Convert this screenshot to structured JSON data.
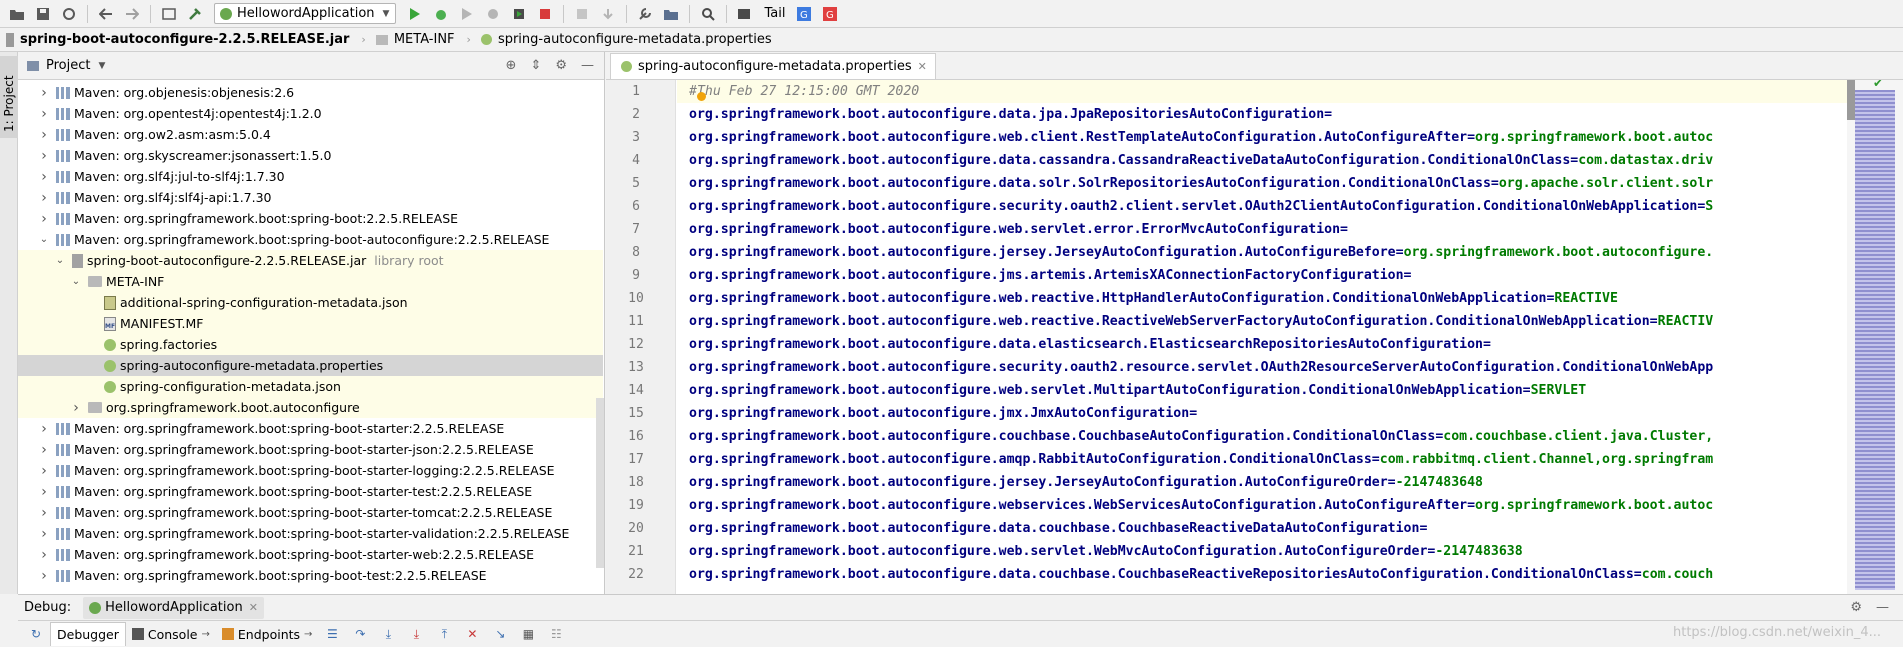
{
  "toolbar": {
    "run_config": "HellowordApplication",
    "tail_label": "Tail"
  },
  "breadcrumb": [
    "spring-boot-autoconfigure-2.2.5.RELEASE.jar",
    "META-INF",
    "spring-autoconfigure-metadata.properties"
  ],
  "side_strip": {
    "label": "1: Project"
  },
  "project_panel": {
    "title": "Project",
    "tree": [
      {
        "depth": 1,
        "arrow": "right",
        "icon": "lib",
        "label": "Maven: org.objenesis:objenesis:2.6"
      },
      {
        "depth": 1,
        "arrow": "right",
        "icon": "lib",
        "label": "Maven: org.opentest4j:opentest4j:1.2.0"
      },
      {
        "depth": 1,
        "arrow": "right",
        "icon": "lib",
        "label": "Maven: org.ow2.asm:asm:5.0.4"
      },
      {
        "depth": 1,
        "arrow": "right",
        "icon": "lib",
        "label": "Maven: org.skyscreamer:jsonassert:1.5.0"
      },
      {
        "depth": 1,
        "arrow": "right",
        "icon": "lib",
        "label": "Maven: org.slf4j:jul-to-slf4j:1.7.30"
      },
      {
        "depth": 1,
        "arrow": "right",
        "icon": "lib",
        "label": "Maven: org.slf4j:slf4j-api:1.7.30"
      },
      {
        "depth": 1,
        "arrow": "right",
        "icon": "lib",
        "label": "Maven: org.springframework.boot:spring-boot:2.2.5.RELEASE"
      },
      {
        "depth": 1,
        "arrow": "down",
        "icon": "lib",
        "label": "Maven: org.springframework.boot:spring-boot-autoconfigure:2.2.5.RELEASE"
      },
      {
        "depth": 2,
        "arrow": "down",
        "icon": "jar",
        "label": "spring-boot-autoconfigure-2.2.5.RELEASE.jar",
        "suffix": "library root",
        "hl": true
      },
      {
        "depth": 3,
        "arrow": "down",
        "icon": "folder",
        "label": "META-INF",
        "hl": true
      },
      {
        "depth": 4,
        "arrow": "",
        "icon": "json",
        "label": "additional-spring-configuration-metadata.json",
        "hl": true
      },
      {
        "depth": 4,
        "arrow": "",
        "icon": "mf",
        "label": "MANIFEST.MF",
        "hl": true
      },
      {
        "depth": 4,
        "arrow": "",
        "icon": "spring",
        "label": "spring.factories",
        "hl": true
      },
      {
        "depth": 4,
        "arrow": "",
        "icon": "spring",
        "label": "spring-autoconfigure-metadata.properties",
        "sel": true
      },
      {
        "depth": 4,
        "arrow": "",
        "icon": "spring",
        "label": "spring-configuration-metadata.json",
        "hl": true
      },
      {
        "depth": 3,
        "arrow": "right",
        "icon": "folder",
        "label": "org.springframework.boot.autoconfigure",
        "hl": true
      },
      {
        "depth": 1,
        "arrow": "right",
        "icon": "lib",
        "label": "Maven: org.springframework.boot:spring-boot-starter:2.2.5.RELEASE"
      },
      {
        "depth": 1,
        "arrow": "right",
        "icon": "lib",
        "label": "Maven: org.springframework.boot:spring-boot-starter-json:2.2.5.RELEASE"
      },
      {
        "depth": 1,
        "arrow": "right",
        "icon": "lib",
        "label": "Maven: org.springframework.boot:spring-boot-starter-logging:2.2.5.RELEASE"
      },
      {
        "depth": 1,
        "arrow": "right",
        "icon": "lib",
        "label": "Maven: org.springframework.boot:spring-boot-starter-test:2.2.5.RELEASE"
      },
      {
        "depth": 1,
        "arrow": "right",
        "icon": "lib",
        "label": "Maven: org.springframework.boot:spring-boot-starter-tomcat:2.2.5.RELEASE"
      },
      {
        "depth": 1,
        "arrow": "right",
        "icon": "lib",
        "label": "Maven: org.springframework.boot:spring-boot-starter-validation:2.2.5.RELEASE"
      },
      {
        "depth": 1,
        "arrow": "right",
        "icon": "lib",
        "label": "Maven: org.springframework.boot:spring-boot-starter-web:2.2.5.RELEASE"
      },
      {
        "depth": 1,
        "arrow": "right",
        "icon": "lib",
        "label": "Maven: org.springframework.boot:spring-boot-test:2.2.5.RELEASE"
      }
    ]
  },
  "editor": {
    "tab_label": "spring-autoconfigure-metadata.properties",
    "lines": [
      {
        "n": "1",
        "comment": "#Thu Feb 27 12:15:00 GMT 2020"
      },
      {
        "n": "2",
        "key": "org.springframework.boot.autoconfigure.data.jpa.JpaRepositoriesAutoConfiguration=",
        "val": ""
      },
      {
        "n": "3",
        "key": "org.springframework.boot.autoconfigure.web.client.RestTemplateAutoConfiguration.AutoConfigureAfter=",
        "val": "org.springframework.boot.autoc"
      },
      {
        "n": "4",
        "key": "org.springframework.boot.autoconfigure.data.cassandra.CassandraReactiveDataAutoConfiguration.ConditionalOnClass=",
        "val": "com.datastax.driv"
      },
      {
        "n": "5",
        "key": "org.springframework.boot.autoconfigure.data.solr.SolrRepositoriesAutoConfiguration.ConditionalOnClass=",
        "val": "org.apache.solr.client.solr"
      },
      {
        "n": "6",
        "key": "org.springframework.boot.autoconfigure.security.oauth2.client.servlet.OAuth2ClientAutoConfiguration.ConditionalOnWebApplication=",
        "val": "S"
      },
      {
        "n": "7",
        "key": "org.springframework.boot.autoconfigure.web.servlet.error.ErrorMvcAutoConfiguration=",
        "val": ""
      },
      {
        "n": "8",
        "key": "org.springframework.boot.autoconfigure.jersey.JerseyAutoConfiguration.AutoConfigureBefore=",
        "val": "org.springframework.boot.autoconfigure."
      },
      {
        "n": "9",
        "key": "org.springframework.boot.autoconfigure.jms.artemis.ArtemisXAConnectionFactoryConfiguration=",
        "val": ""
      },
      {
        "n": "10",
        "key": "org.springframework.boot.autoconfigure.web.reactive.HttpHandlerAutoConfiguration.ConditionalOnWebApplication=",
        "val": "REACTIVE"
      },
      {
        "n": "11",
        "key": "org.springframework.boot.autoconfigure.web.reactive.ReactiveWebServerFactoryAutoConfiguration.ConditionalOnWebApplication=",
        "val": "REACTIV"
      },
      {
        "n": "12",
        "key": "org.springframework.boot.autoconfigure.data.elasticsearch.ElasticsearchRepositoriesAutoConfiguration=",
        "val": ""
      },
      {
        "n": "13",
        "key": "org.springframework.boot.autoconfigure.security.oauth2.resource.servlet.OAuth2ResourceServerAutoConfiguration.ConditionalOnWebApp",
        "val": ""
      },
      {
        "n": "14",
        "key": "org.springframework.boot.autoconfigure.web.servlet.MultipartAutoConfiguration.ConditionalOnWebApplication=",
        "val": "SERVLET"
      },
      {
        "n": "15",
        "key": "org.springframework.boot.autoconfigure.jmx.JmxAutoConfiguration=",
        "val": ""
      },
      {
        "n": "16",
        "key": "org.springframework.boot.autoconfigure.couchbase.CouchbaseAutoConfiguration.ConditionalOnClass=",
        "val": "com.couchbase.client.java.Cluster,"
      },
      {
        "n": "17",
        "key": "org.springframework.boot.autoconfigure.amqp.RabbitAutoConfiguration.ConditionalOnClass=",
        "val": "com.rabbitmq.client.Channel,org.springfram"
      },
      {
        "n": "18",
        "key": "org.springframework.boot.autoconfigure.jersey.JerseyAutoConfiguration.AutoConfigureOrder=",
        "val": "-2147483648"
      },
      {
        "n": "19",
        "key": "org.springframework.boot.autoconfigure.webservices.WebServicesAutoConfiguration.AutoConfigureAfter=",
        "val": "org.springframework.boot.autoc"
      },
      {
        "n": "20",
        "key": "org.springframework.boot.autoconfigure.data.couchbase.CouchbaseReactiveDataAutoConfiguration=",
        "val": ""
      },
      {
        "n": "21",
        "key": "org.springframework.boot.autoconfigure.web.servlet.WebMvcAutoConfiguration.AutoConfigureOrder=",
        "val": "-2147483638"
      },
      {
        "n": "22",
        "key": "org.springframework.boot.autoconfigure.data.couchbase.CouchbaseReactiveRepositoriesAutoConfiguration.ConditionalOnClass=",
        "val": "com.couch"
      }
    ]
  },
  "debug": {
    "label": "Debug:",
    "session_tab": "HellowordApplication",
    "tabs": [
      "Debugger",
      "Console",
      "Endpoints"
    ],
    "watermark": "https://blog.csdn.net/weixin_4..."
  },
  "colors": {
    "key": "#00007f",
    "value": "#007a00",
    "comment": "#808080",
    "highlight": "#fefde7",
    "selected": "#d5d5d5"
  }
}
